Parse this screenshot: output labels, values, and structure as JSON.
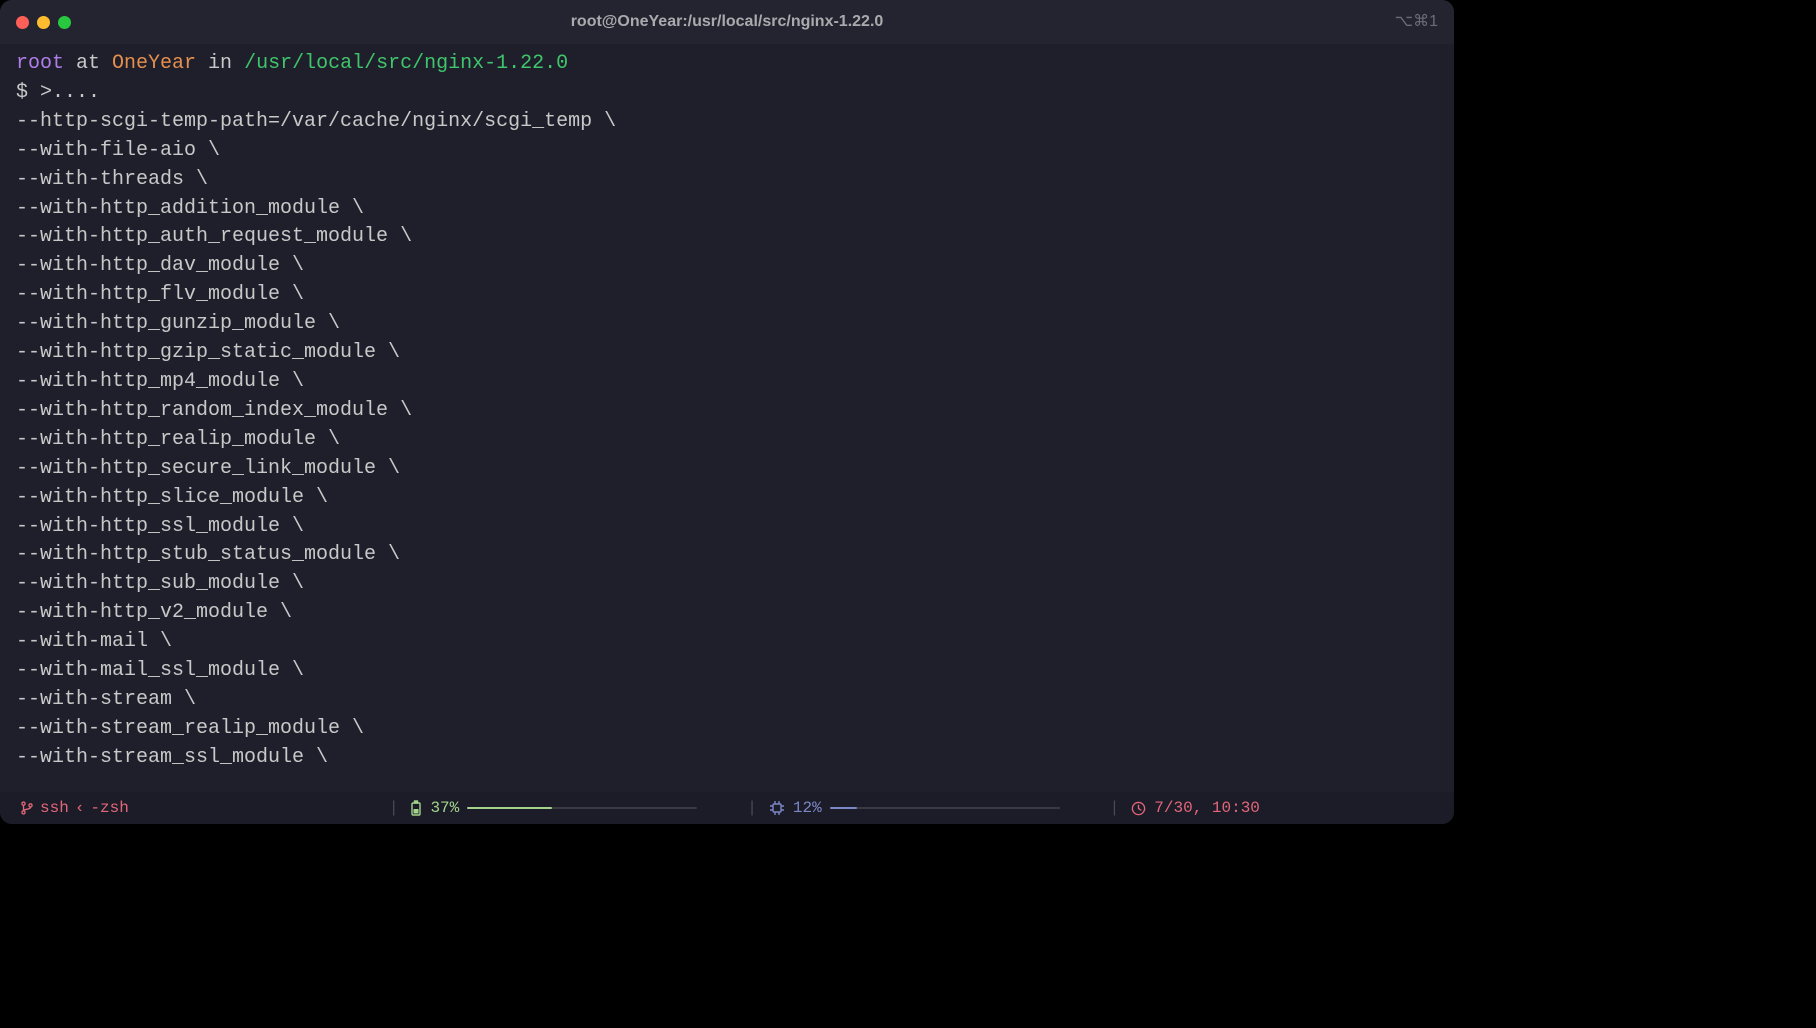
{
  "window": {
    "title": "root@OneYear:/usr/local/src/nginx-1.22.0",
    "shortcut_hint": "⌥⌘1"
  },
  "prompt": {
    "user": "root",
    "at": " at ",
    "host": "OneYear",
    "in": " in ",
    "path": "/usr/local/src/nginx-1.22.0",
    "line2": "$ >...."
  },
  "output_lines": [
    "--http-scgi-temp-path=/var/cache/nginx/scgi_temp \\",
    "--with-file-aio \\",
    "--with-threads \\",
    "--with-http_addition_module \\",
    "--with-http_auth_request_module \\",
    "--with-http_dav_module \\",
    "--with-http_flv_module \\",
    "--with-http_gunzip_module \\",
    "--with-http_gzip_static_module \\",
    "--with-http_mp4_module \\",
    "--with-http_random_index_module \\",
    "--with-http_realip_module \\",
    "--with-http_secure_link_module \\",
    "--with-http_slice_module \\",
    "--with-http_ssl_module \\",
    "--with-http_stub_status_module \\",
    "--with-http_sub_module \\",
    "--with-http_v2_module \\",
    "--with-mail \\",
    "--with-mail_ssl_module \\",
    "--with-stream \\",
    "--with-stream_realip_module \\",
    "--with-stream_ssl_module \\"
  ],
  "status": {
    "session": "ssh",
    "separator": "‹",
    "process": "-zsh",
    "battery_pct": "37%",
    "cpu_pct": "12%",
    "clock": "7/30, 10:30"
  }
}
